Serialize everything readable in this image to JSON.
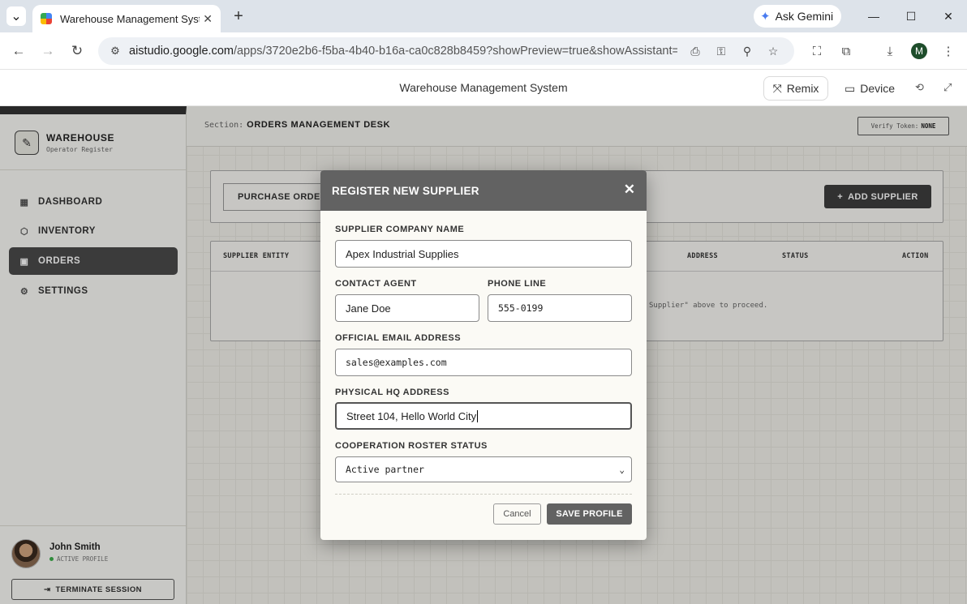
{
  "browser": {
    "tab_title": "Warehouse Management System",
    "url_host": "aistudio.google.com",
    "url_path": "/apps/3720e2b6-f5ba-4b40-b16a-ca0c828b8459?showPreview=true&showAssistant=tr...",
    "ask_gemini": "Ask Gemini",
    "profile_initial": "M"
  },
  "studio": {
    "title": "Warehouse Management System",
    "remix": "Remix",
    "device": "Device"
  },
  "sidebar": {
    "brand_name": "WAREHOUSE",
    "brand_sub": "Operator Register",
    "items": [
      {
        "label": "DASHBOARD",
        "icon": "grid-icon"
      },
      {
        "label": "INVENTORY",
        "icon": "box-icon"
      },
      {
        "label": "ORDERS",
        "icon": "clipboard-icon",
        "active": true
      },
      {
        "label": "SETTINGS",
        "icon": "gear-icon"
      }
    ],
    "user_name": "John Smith",
    "user_status": "ACTIVE PROFILE",
    "terminate": "TERMINATE SESSION"
  },
  "main": {
    "section_label": "Section:",
    "section_value": "ORDERS MANAGEMENT DESK",
    "verify_label": "Verify Token:",
    "verify_value": "NONE",
    "po_tab": "PURCHASE ORDERS",
    "add_supplier": "ADD SUPPLIER",
    "columns": [
      "SUPPLIER ENTITY",
      "ADDRESS",
      "STATUS",
      "ACTION"
    ],
    "empty_message": "Supplier\" above to proceed."
  },
  "modal": {
    "title": "REGISTER NEW SUPPLIER",
    "company_label": "SUPPLIER COMPANY NAME",
    "company_value": "Apex Industrial Supplies",
    "contact_label": "CONTACT AGENT",
    "contact_value": "Jane Doe",
    "phone_label": "PHONE LINE",
    "phone_value": "555-0199",
    "email_label": "OFFICIAL EMAIL ADDRESS",
    "email_value": "sales@examples.com",
    "address_label": "PHYSICAL HQ ADDRESS",
    "address_value": "Street 104, Hello World City",
    "status_label": "COOPERATION ROSTER STATUS",
    "status_value": "Active partner",
    "cancel": "Cancel",
    "save": "SAVE PROFILE"
  }
}
